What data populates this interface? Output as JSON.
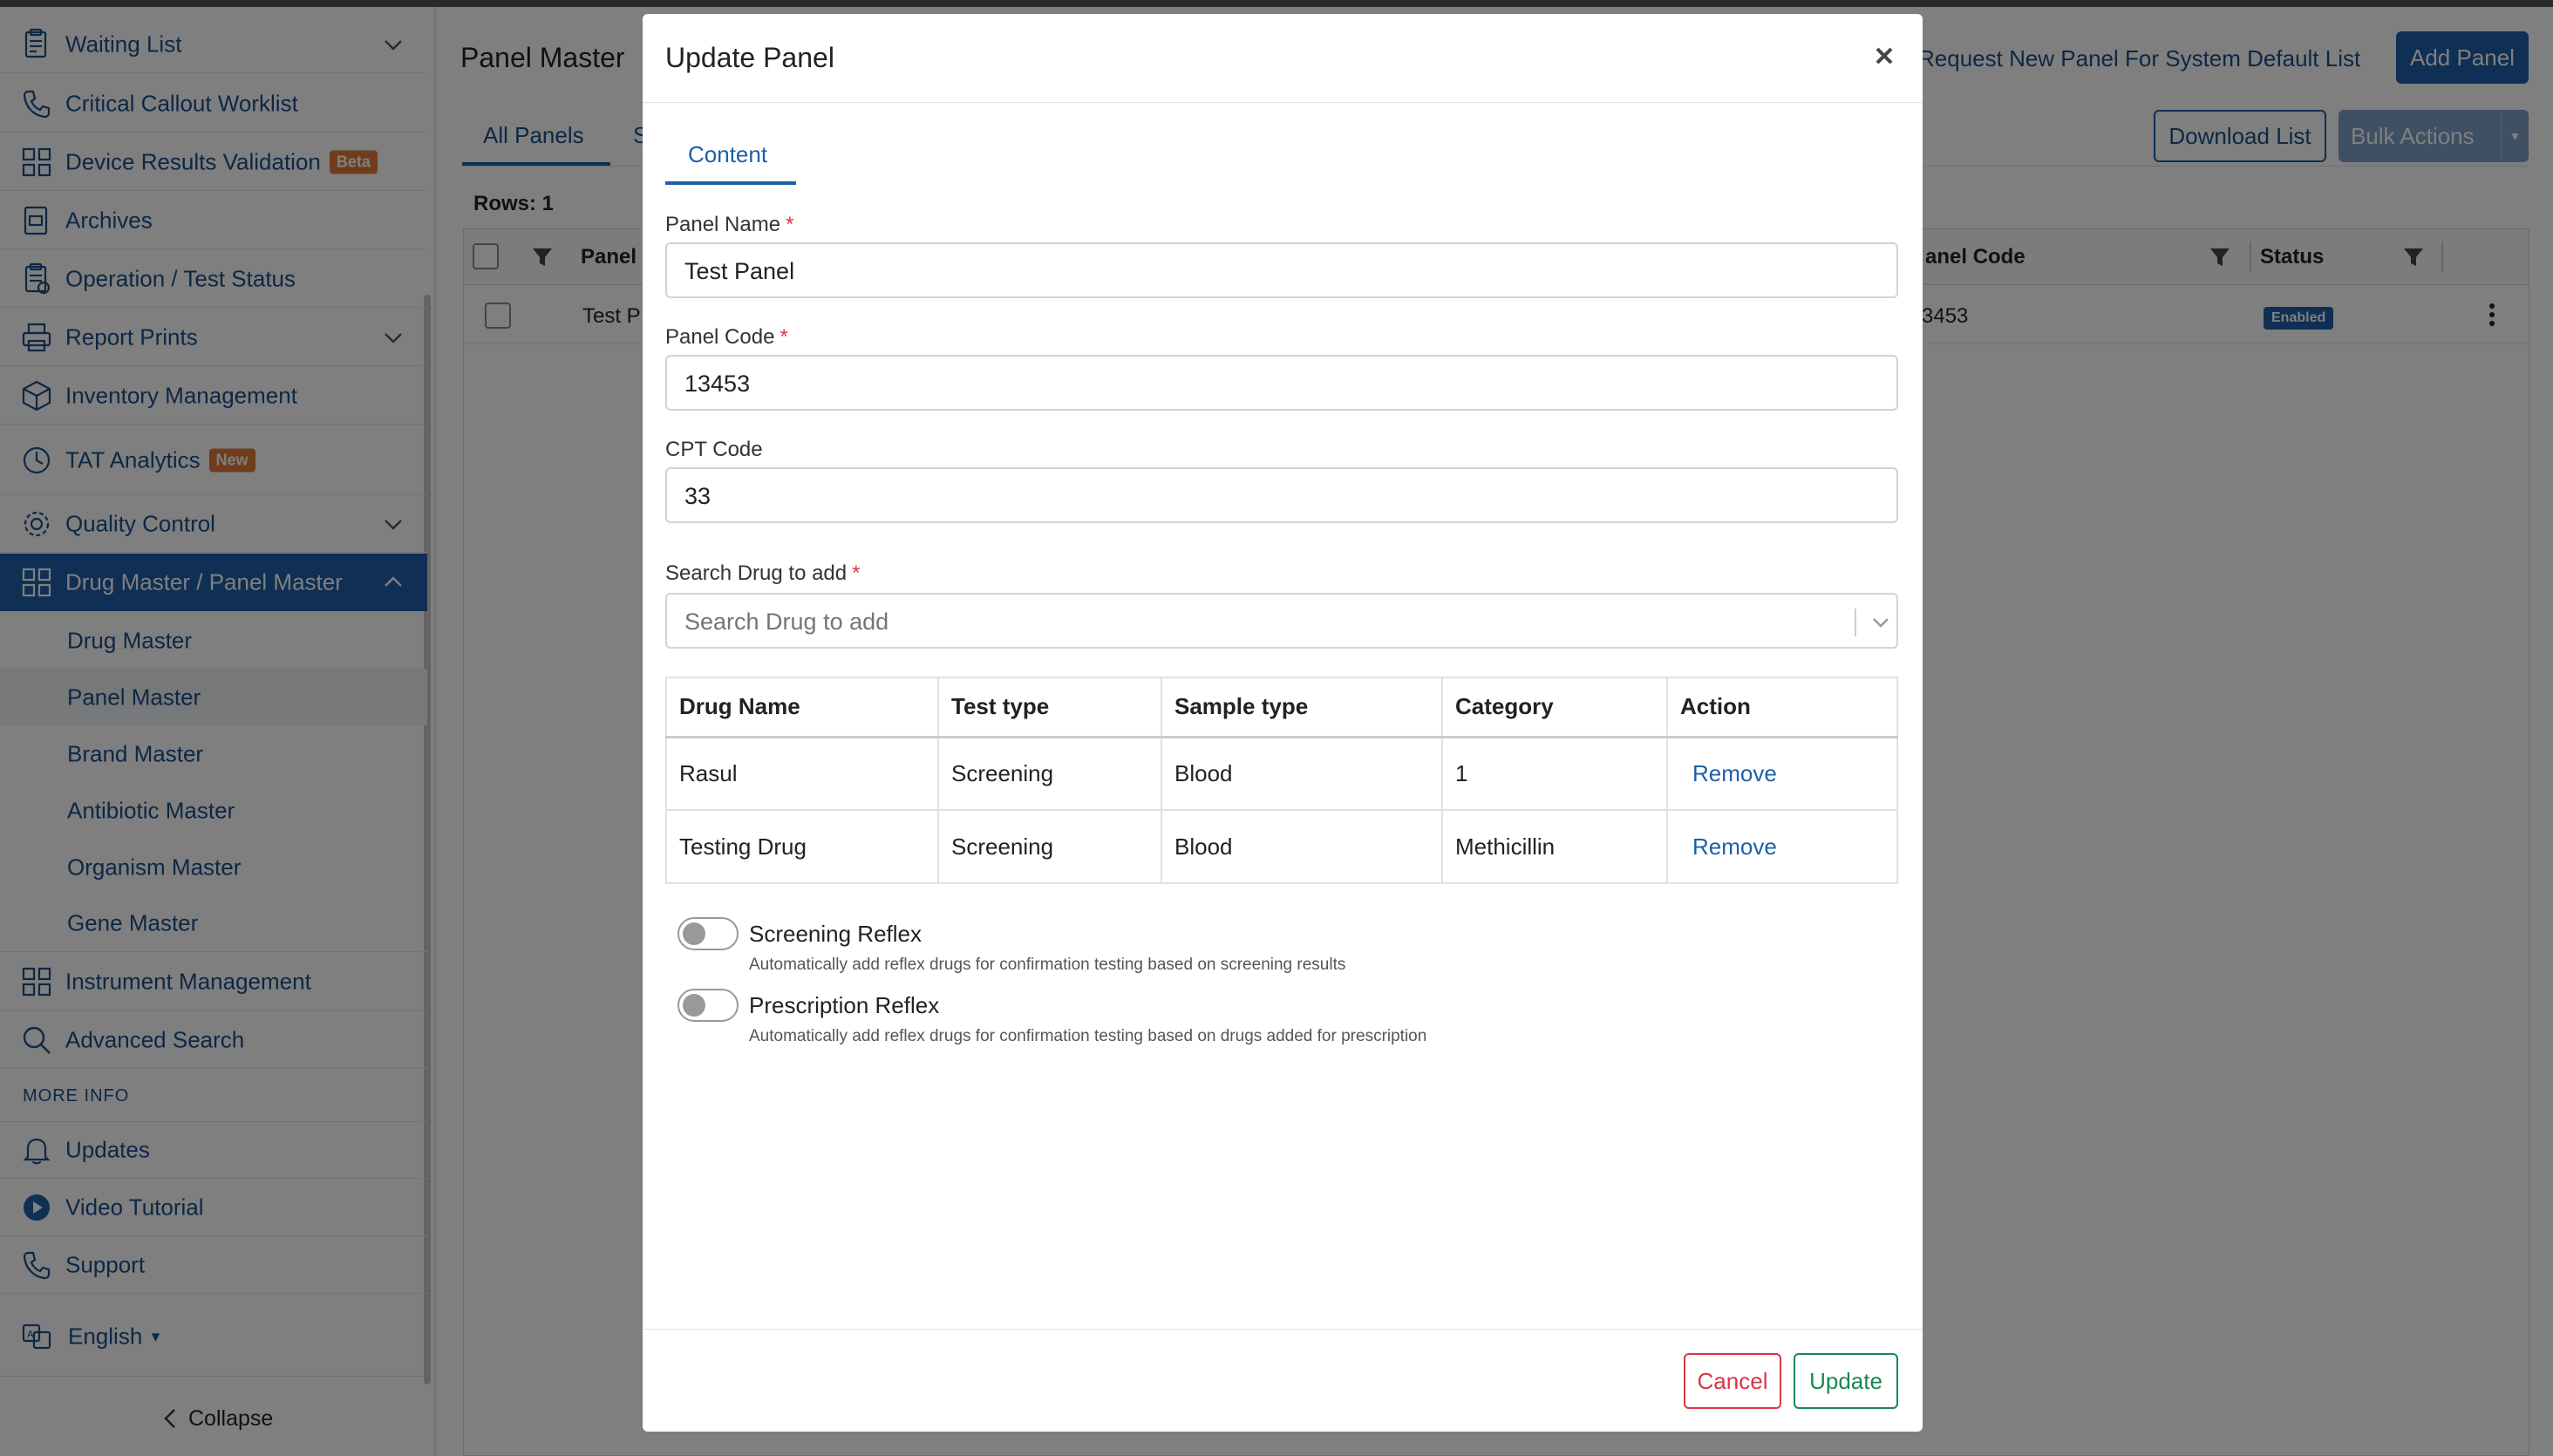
{
  "sidebar": {
    "items": [
      {
        "label": "Waiting List",
        "icon": "clipboard-icon"
      },
      {
        "label": "Critical Callout Worklist",
        "icon": "phone-icon"
      },
      {
        "label": "Device Results Validation",
        "icon": "grid-icon",
        "badge": "Beta"
      },
      {
        "label": "Archives",
        "icon": "archive-icon"
      },
      {
        "label": "Operation / Test Status",
        "icon": "clipboard-icon"
      },
      {
        "label": "Report Prints",
        "icon": "printer-icon"
      },
      {
        "label": "Inventory Management",
        "icon": "box-icon"
      },
      {
        "label": "TAT Analytics",
        "icon": "clock-icon",
        "badge": "New"
      },
      {
        "label": "Quality Control",
        "icon": "gear-icon"
      },
      {
        "label": "Drug Master / Panel Master",
        "icon": "grid-icon"
      }
    ],
    "sub_items": [
      "Drug Master",
      "Panel Master",
      "Brand Master",
      "Antibiotic Master",
      "Organism Master",
      "Gene Master"
    ],
    "after_items": [
      {
        "label": "Instrument Management",
        "icon": "grid-icon"
      },
      {
        "label": "Advanced Search",
        "icon": "search-icon"
      }
    ],
    "more_info_heading": "MORE INFO",
    "info_items": [
      {
        "label": "Updates",
        "icon": "bell-icon"
      },
      {
        "label": "Video Tutorial",
        "icon": "play-icon"
      },
      {
        "label": "Support",
        "icon": "phone-icon"
      }
    ],
    "language": "English",
    "collapse_label": "Collapse"
  },
  "main": {
    "title": "Panel Master",
    "tab_all": "All Panels",
    "tab_second_fragment": "S",
    "rows_label": "Rows: 1",
    "request_link": "Request New Panel For System Default List",
    "add_button": "Add Panel",
    "download_button": "Download List",
    "bulk_button": "Bulk Actions",
    "grid": {
      "col_panel": "Panel",
      "col_code": "anel Code",
      "col_status": "Status",
      "row_name": "Test P",
      "row_code": "3453",
      "row_status": "Enabled"
    }
  },
  "modal": {
    "title": "Update Panel",
    "tab": "Content",
    "panel_name_label": "Panel Name",
    "panel_name_value": "Test Panel",
    "panel_code_label": "Panel Code",
    "panel_code_value": "13453",
    "cpt_code_label": "CPT Code",
    "cpt_code_value": "33",
    "search_drug_label": "Search Drug to add",
    "search_drug_placeholder": "Search Drug to add",
    "required_mark": "*",
    "table": {
      "headers": [
        "Drug Name",
        "Test type",
        "Sample type",
        "Category",
        "Action"
      ],
      "rows": [
        [
          "Rasul",
          "Screening",
          "Blood",
          "1",
          "Remove"
        ],
        [
          "Testing Drug",
          "Screening",
          "Blood",
          "Methicillin",
          "Remove"
        ]
      ]
    },
    "screening_reflex_label": "Screening Reflex",
    "screening_reflex_help": "Automatically add reflex drugs for confirmation testing based on screening results",
    "prescription_reflex_label": "Prescription Reflex",
    "prescription_reflex_help": "Automatically add reflex drugs for confirmation testing based on drugs added for prescription",
    "cancel_button": "Cancel",
    "update_button": "Update"
  },
  "colors": {
    "primary": "#1e5fa8",
    "badge_beta": "#e07b39",
    "badge_new": "#e07b39",
    "danger": "#dc3545",
    "success": "#198754"
  }
}
